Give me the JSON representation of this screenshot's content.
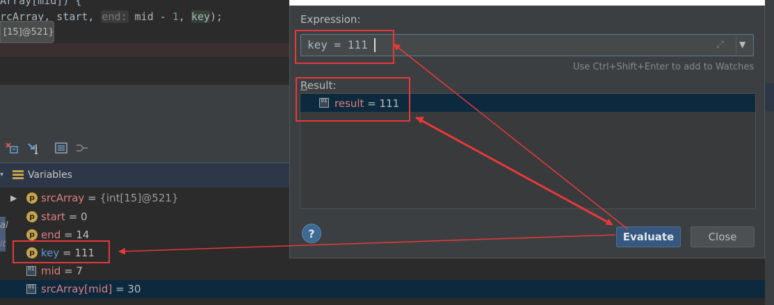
{
  "editor": {
    "line1_prefix": "Array[mid]) {",
    "line2": {
      "prefix": "rcArray, start, ",
      "hint": "end:",
      "mid": " mid - ",
      "one": "1",
      "comma": ", ",
      "key": "key",
      "suffix": ");"
    },
    "tooltip": "[15]@521}"
  },
  "variables_panel": {
    "title": "Variables",
    "items": [
      {
        "expand": "▶",
        "badge": "p",
        "name": "srcArray",
        "eq": " = ",
        "value": "{int[15]@521}"
      },
      {
        "badge": "p",
        "name": "start",
        "eq": " = ",
        "value": "0"
      },
      {
        "badge": "p",
        "name": "end",
        "eq": " = ",
        "value": "14"
      },
      {
        "badge": "p",
        "name": "key",
        "eq": " = ",
        "value": "111"
      },
      {
        "badge": "01",
        "name": "mid",
        "eq": " = ",
        "value": "7"
      },
      {
        "badge": "01",
        "name": "srcArray[mid]",
        "eq": " = ",
        "value": "30"
      }
    ],
    "side_labels": [
      "al",
      "it"
    ]
  },
  "dialog": {
    "expression_label": "Expression:",
    "expression_value": "key = 111",
    "watch_hint": "Use Ctrl+Shift+Enter to add to Watches",
    "result_label_first": "R",
    "result_label_rest": "esult:",
    "result_name": "result",
    "result_eq": " = ",
    "result_value": "111",
    "help_label": "?",
    "evaluate_label": "Evaluate",
    "close_label": "Close"
  },
  "colors": {
    "annotation_red": "#e8393a",
    "selection_blue": "#0d293e",
    "primary_button": "#365880"
  }
}
